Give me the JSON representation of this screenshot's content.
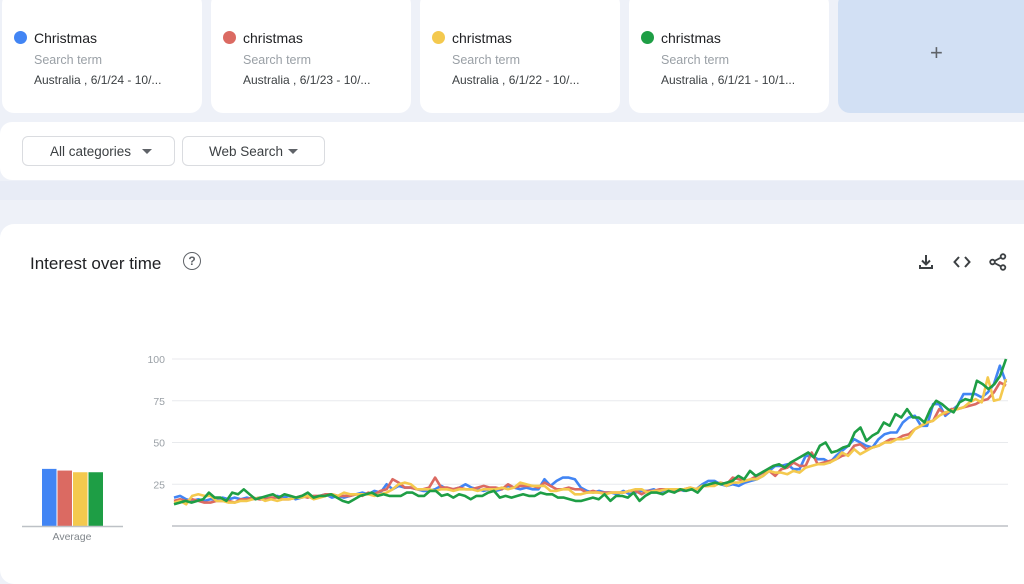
{
  "terms": [
    {
      "name": "Christmas",
      "type": "Search term",
      "location": "Australia , 6/1/24 - 10/...",
      "color": "#4285f4"
    },
    {
      "name": "christmas",
      "type": "Search term",
      "location": "Australia , 6/1/23 - 10/...",
      "color": "#db6a62"
    },
    {
      "name": "christmas",
      "type": "Search term",
      "location": "Australia , 6/1/22 - 10/...",
      "color": "#f4c94e"
    },
    {
      "name": "christmas",
      "type": "Search term",
      "location": "Australia , 6/1/21 - 10/1...",
      "color": "#1e9e45"
    }
  ],
  "add_term": {
    "icon": "plus-icon",
    "label": "+"
  },
  "filters": {
    "category": "All categories",
    "search_type": "Web Search"
  },
  "chart_card": {
    "title": "Interest over time",
    "help_icon": "question-circle-icon",
    "actions": [
      "download-icon",
      "embed-code-icon",
      "share-icon"
    ]
  },
  "chart_data": [
    {
      "type": "bar",
      "title": "Average",
      "categories": [
        "Christmas (6/1/24)",
        "christmas (6/1/23)",
        "christmas (6/1/22)",
        "christmas (6/1/21)"
      ],
      "values": [
        34,
        33,
        32,
        32
      ],
      "colors": [
        "#4285f4",
        "#db6a62",
        "#f4c94e",
        "#1e9e45"
      ],
      "xlabel": "Average",
      "ylim": [
        0,
        100
      ]
    },
    {
      "type": "line",
      "title": "Interest over time",
      "xlabel": "",
      "ylabel": "",
      "yticks": [
        25,
        50,
        75,
        100
      ],
      "ylim": [
        0,
        100
      ],
      "grid": true,
      "series": [
        {
          "name": "Christmas",
          "color": "#4285f4",
          "values": [
            17,
            18,
            16,
            15,
            16,
            15,
            16,
            16,
            17,
            16,
            17,
            16,
            17,
            16,
            17,
            17,
            16,
            18,
            17,
            18,
            16,
            17,
            18,
            17,
            18,
            19,
            17,
            18,
            17,
            18,
            19,
            20,
            19,
            21,
            20,
            25,
            22,
            24,
            23,
            23,
            22,
            21,
            21,
            22,
            24,
            22,
            22,
            23,
            25,
            23,
            22,
            21,
            22,
            21,
            22,
            24,
            23,
            22,
            23,
            22,
            22,
            28,
            24,
            27,
            29,
            29,
            28,
            23,
            21,
            20,
            21,
            20,
            20,
            19,
            21,
            19,
            20,
            21,
            21,
            22,
            20,
            22,
            21,
            22,
            21,
            22,
            22,
            25,
            27,
            27,
            25,
            24,
            25,
            24,
            26,
            27,
            28,
            30,
            33,
            36,
            36,
            37,
            34,
            34,
            42,
            42,
            40,
            40,
            38,
            42,
            45,
            48,
            52,
            50,
            48,
            47,
            52,
            55,
            56,
            56,
            62,
            65,
            66,
            60,
            60,
            73,
            73,
            66,
            69,
            72,
            79,
            79,
            79,
            77,
            80,
            85,
            96,
            86
          ]
        },
        {
          "name": "christmas",
          "color": "#db6a62",
          "values": [
            15,
            16,
            15,
            16,
            15,
            14,
            14,
            15,
            15,
            15,
            14,
            16,
            16,
            17,
            16,
            16,
            17,
            17,
            16,
            16,
            17,
            18,
            17,
            18,
            18,
            19,
            19,
            18,
            18,
            18,
            19,
            18,
            20,
            19,
            21,
            22,
            28,
            26,
            23,
            23,
            22,
            22,
            23,
            29,
            23,
            23,
            22,
            23,
            22,
            22,
            23,
            24,
            23,
            23,
            22,
            25,
            23,
            24,
            24,
            24,
            23,
            26,
            24,
            22,
            22,
            23,
            22,
            22,
            20,
            21,
            20,
            20,
            20,
            20,
            20,
            21,
            21,
            19,
            21,
            21,
            22,
            22,
            21,
            21,
            22,
            23,
            22,
            24,
            24,
            25,
            26,
            25,
            29,
            28,
            27,
            28,
            30,
            32,
            33,
            30,
            34,
            35,
            38,
            36,
            36,
            44,
            37,
            38,
            39,
            40,
            42,
            43,
            48,
            49,
            46,
            47,
            48,
            50,
            52,
            52,
            54,
            55,
            58,
            60,
            62,
            63,
            70,
            67,
            70,
            70,
            71,
            72,
            73,
            75,
            76,
            80,
            86,
            84
          ]
        },
        {
          "name": "christmas",
          "color": "#f4c94e",
          "values": [
            14,
            15,
            13,
            18,
            19,
            18,
            18,
            15,
            15,
            14,
            14,
            15,
            15,
            16,
            17,
            15,
            16,
            15,
            16,
            16,
            17,
            17,
            18,
            16,
            17,
            18,
            19,
            18,
            20,
            19,
            19,
            19,
            19,
            18,
            19,
            20,
            22,
            25,
            26,
            25,
            22,
            22,
            22,
            21,
            22,
            22,
            21,
            22,
            22,
            22,
            21,
            22,
            22,
            22,
            23,
            22,
            23,
            26,
            25,
            24,
            24,
            24,
            21,
            21,
            22,
            22,
            19,
            19,
            20,
            20,
            20,
            19,
            20,
            20,
            20,
            21,
            22,
            22,
            20,
            21,
            21,
            22,
            22,
            22,
            22,
            23,
            22,
            24,
            24,
            24,
            26,
            24,
            26,
            26,
            27,
            28,
            28,
            30,
            33,
            32,
            32,
            31,
            33,
            32,
            35,
            36,
            37,
            37,
            38,
            40,
            44,
            42,
            46,
            43,
            45,
            47,
            48,
            50,
            50,
            52,
            52,
            53,
            58,
            60,
            62,
            63,
            66,
            68,
            69,
            70,
            71,
            74,
            76,
            74,
            89,
            75,
            76,
            88
          ]
        },
        {
          "name": "christmas",
          "color": "#1e9e45",
          "values": [
            13,
            14,
            15,
            14,
            15,
            16,
            20,
            17,
            17,
            15,
            20,
            19,
            22,
            19,
            16,
            17,
            18,
            19,
            17,
            19,
            18,
            17,
            18,
            20,
            17,
            18,
            18,
            19,
            17,
            15,
            14,
            16,
            18,
            19,
            20,
            18,
            19,
            18,
            18,
            18,
            20,
            20,
            18,
            18,
            21,
            21,
            18,
            19,
            17,
            19,
            18,
            16,
            18,
            18,
            20,
            21,
            17,
            18,
            17,
            18,
            19,
            18,
            18,
            20,
            19,
            19,
            17,
            17,
            16,
            15,
            15,
            16,
            17,
            16,
            19,
            15,
            18,
            18,
            17,
            20,
            15,
            18,
            20,
            20,
            19,
            21,
            20,
            22,
            21,
            22,
            20,
            24,
            25,
            26,
            25,
            26,
            27,
            30,
            28,
            33,
            30,
            32,
            34,
            36,
            37,
            35,
            38,
            40,
            42,
            44,
            41,
            48,
            50,
            44,
            45,
            47,
            48,
            56,
            59,
            51,
            54,
            56,
            62,
            60,
            67,
            65,
            70,
            65,
            65,
            62,
            70,
            75,
            73,
            70,
            68,
            74,
            76,
            75,
            87,
            85,
            82,
            85,
            90,
            100
          ]
        }
      ]
    }
  ]
}
